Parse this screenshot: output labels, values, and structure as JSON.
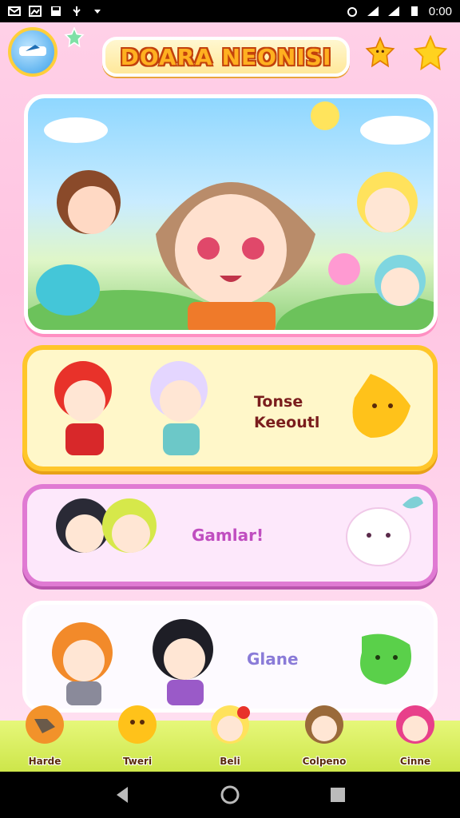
{
  "status_bar": {
    "time": "0:00"
  },
  "header": {
    "title": "DOARA NEONISI"
  },
  "cards": [
    {
      "label_line1": "Tonse",
      "label_line2": "Keeoutl"
    },
    {
      "label": "Gamlar!"
    },
    {
      "label": "Glane"
    }
  ],
  "nav": {
    "items": [
      {
        "label": "Harde"
      },
      {
        "label": "Tweri"
      },
      {
        "label": "Beli"
      },
      {
        "label": "Colpeno"
      },
      {
        "label": "Cinne"
      }
    ]
  },
  "colors": {
    "accent_yellow": "#ffc62a",
    "accent_pink": "#e07ad3",
    "nav_bg": "#d6ec5a",
    "title_fill": "#ffb020",
    "title_outline": "#c2410c"
  },
  "icons": [
    "logo-icon",
    "star-icon",
    "triangle-back-icon",
    "circle-home-icon",
    "square-recents-icon"
  ]
}
